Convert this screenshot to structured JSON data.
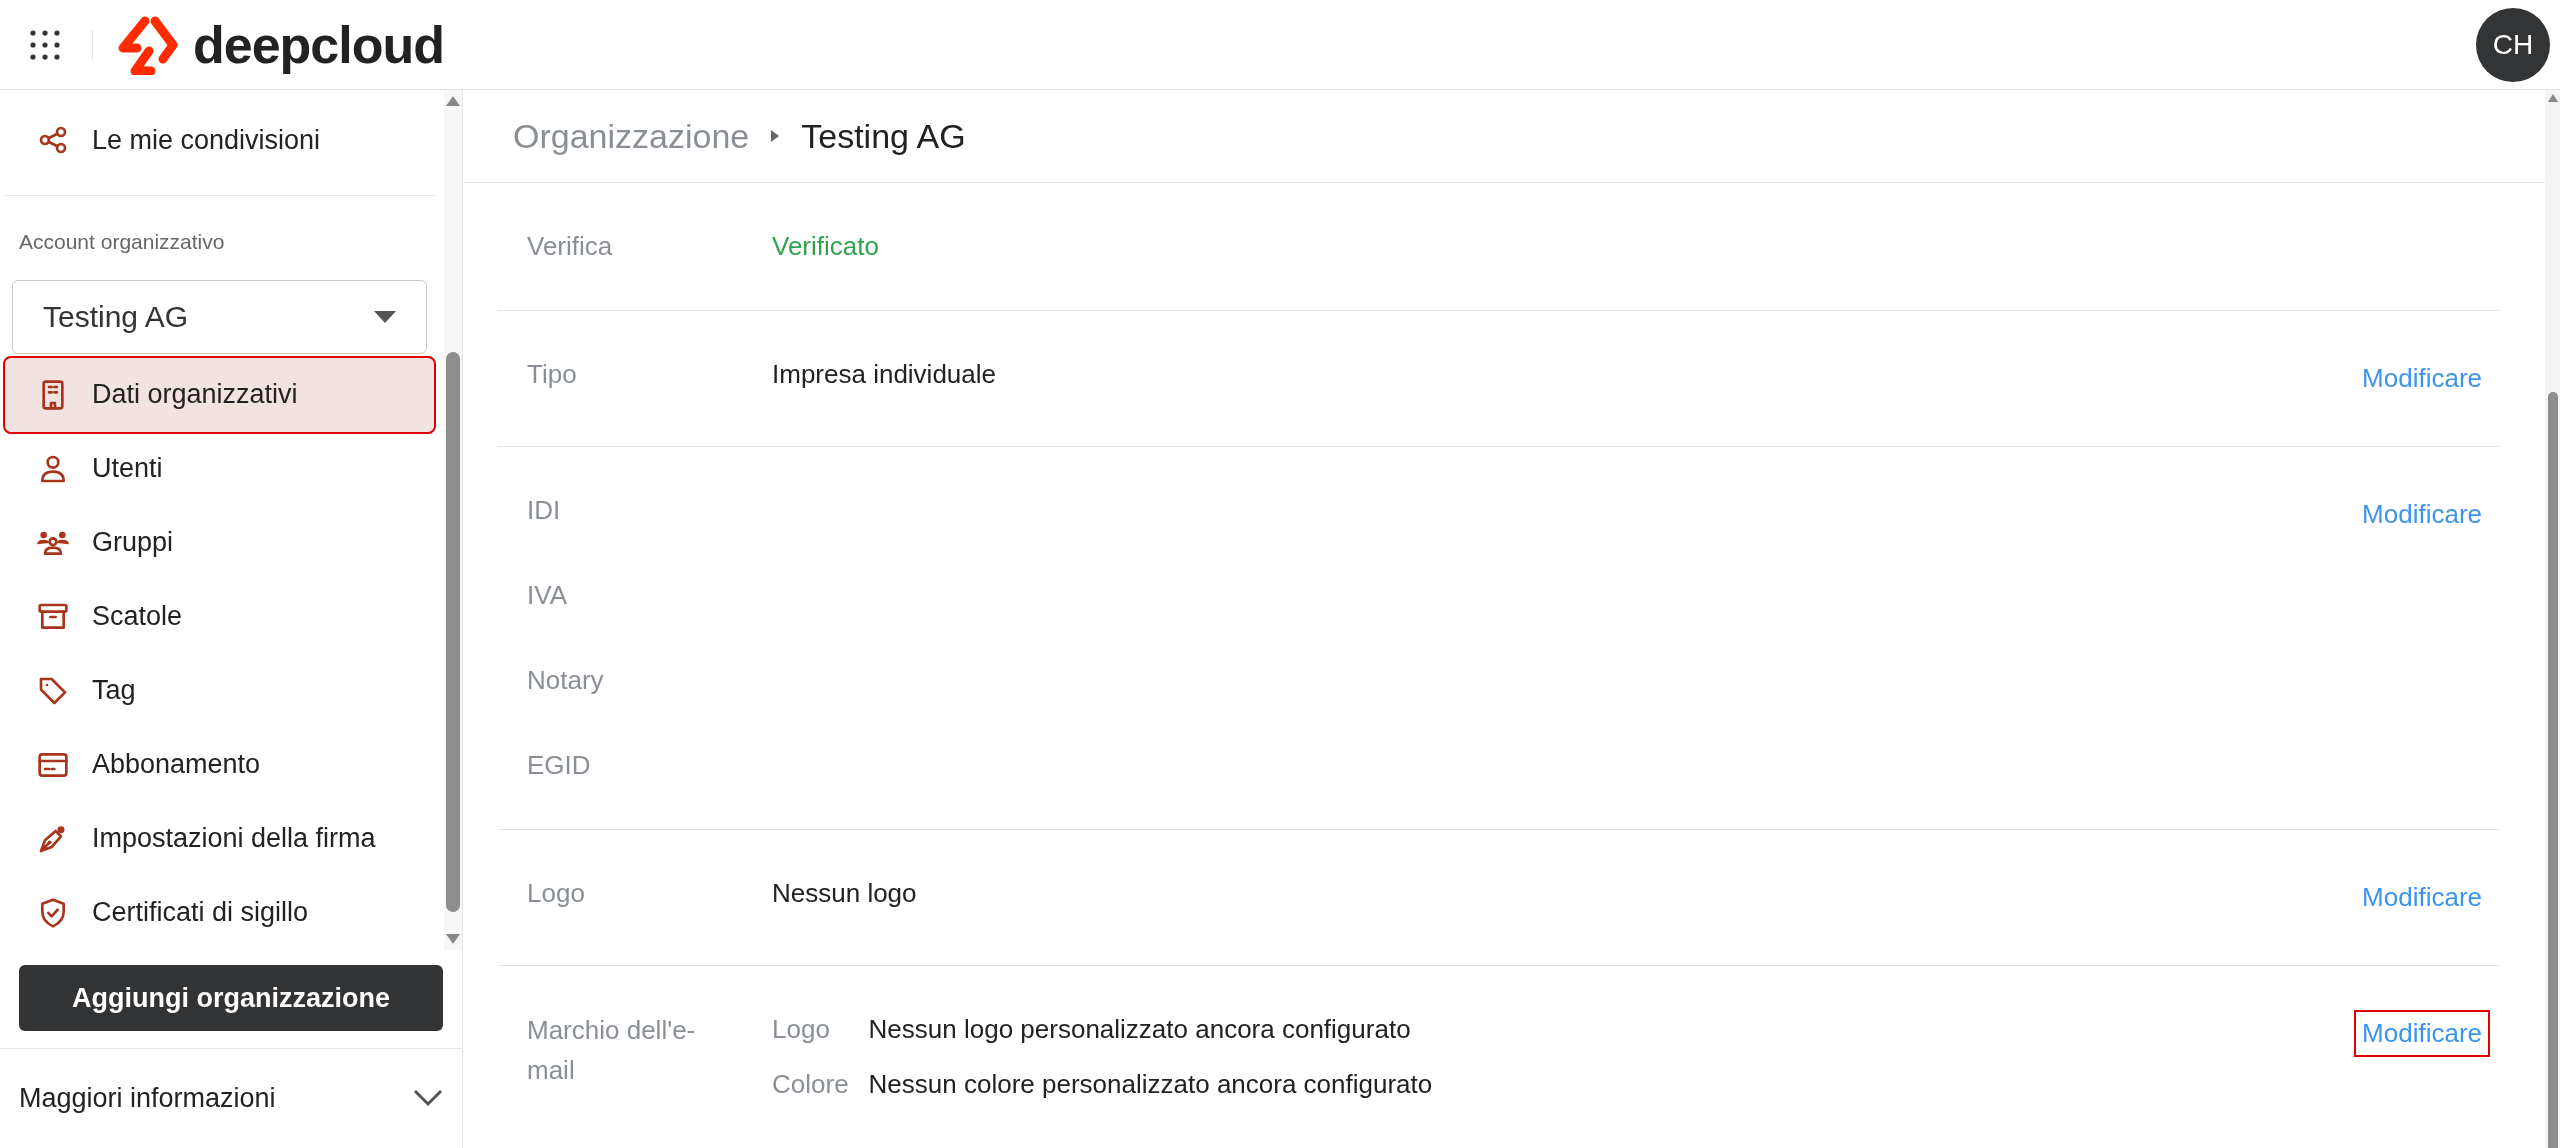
{
  "header": {
    "logo_text": "deepcloud",
    "avatar_initials": "CH"
  },
  "sidebar": {
    "top_items": [
      {
        "label": "Le mie condivisioni",
        "selected": false
      }
    ],
    "section_title": "Account organizzativo",
    "org_select": {
      "value": "Testing AG"
    },
    "items": [
      {
        "label": "Dati organizzativi",
        "selected": true
      },
      {
        "label": "Utenti",
        "selected": false
      },
      {
        "label": "Gruppi",
        "selected": false
      },
      {
        "label": "Scatole",
        "selected": false
      },
      {
        "label": "Tag",
        "selected": false
      },
      {
        "label": "Abbonamento",
        "selected": false
      },
      {
        "label": "Impostazioni della firma",
        "selected": false
      },
      {
        "label": "Certificati di sigillo",
        "selected": false
      }
    ],
    "add_button": "Aggiungi organizzazione",
    "more_info": {
      "label": "Maggiori informazioni",
      "expanded": false
    }
  },
  "breadcrumb": [
    "Organizzazione",
    "Testing AG"
  ],
  "rows": [
    {
      "kind": "status",
      "label": "Verifica",
      "value": "Verificato"
    },
    {
      "kind": "plain",
      "label": "Tipo",
      "value": "Impresa individuale",
      "action": "Modificare",
      "action_highlighted": false
    },
    {
      "kind": "multi",
      "labels": [
        "IDI",
        "IVA",
        "Notary",
        "EGID"
      ],
      "action": "Modificare",
      "action_highlighted": false
    },
    {
      "kind": "plain",
      "label": "Logo",
      "value": "Nessun logo",
      "action": "Modificare",
      "action_highlighted": false
    },
    {
      "kind": "pairs",
      "label": "Marchio dell'e-mail",
      "pairs": [
        {
          "key": "Logo",
          "value": "Nessun logo personalizzato ancora configurato"
        },
        {
          "key": "Colore",
          "value": "Nessun colore personalizzato ancora configurato"
        }
      ],
      "action": "Modificare",
      "action_highlighted": true
    }
  ]
}
